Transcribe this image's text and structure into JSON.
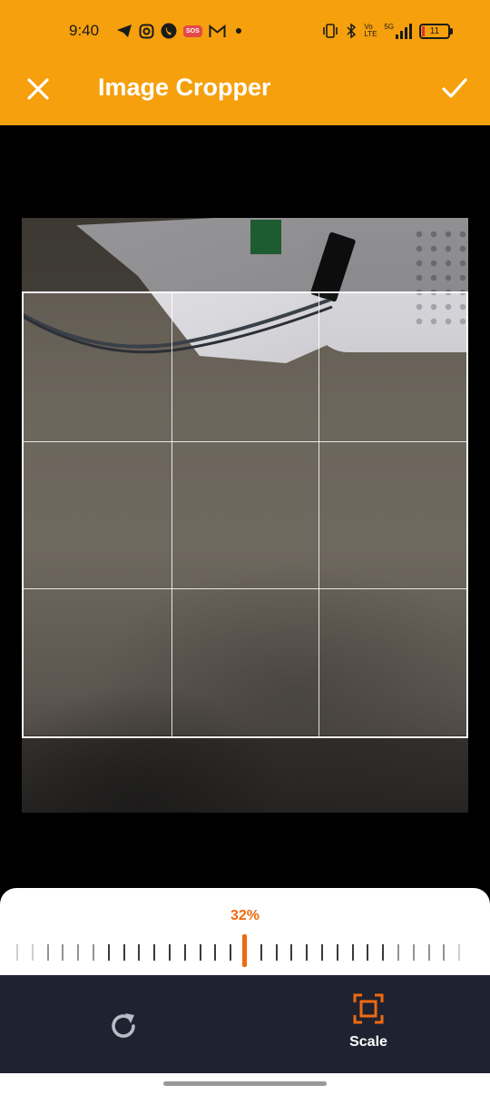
{
  "status_bar": {
    "time": "9:40",
    "sos_label": "SOS",
    "network_label": "5G",
    "volte_label": "Vo LTE",
    "battery_level": "11",
    "icons_left": [
      "telegram-icon",
      "instagram-icon",
      "phone-icon",
      "sos-icon",
      "gmail-icon",
      "dot-icon"
    ],
    "icons_right": [
      "vibrate-icon",
      "bluetooth-icon",
      "volte-icon",
      "signal-icon",
      "battery-icon"
    ]
  },
  "app_bar": {
    "title": "Image Cropper",
    "close_icon": "close-icon",
    "confirm_icon": "check-icon",
    "background": "#f5a00c"
  },
  "editor": {
    "crop_grid": "3x3"
  },
  "zoom": {
    "value_label": "32%",
    "value": 32,
    "accent": "#f06a10"
  },
  "toolbar": {
    "rotate_icon": "rotate-icon",
    "scale_icon": "crop-scale-icon",
    "scale_label": "Scale",
    "background": "#1f2230"
  }
}
